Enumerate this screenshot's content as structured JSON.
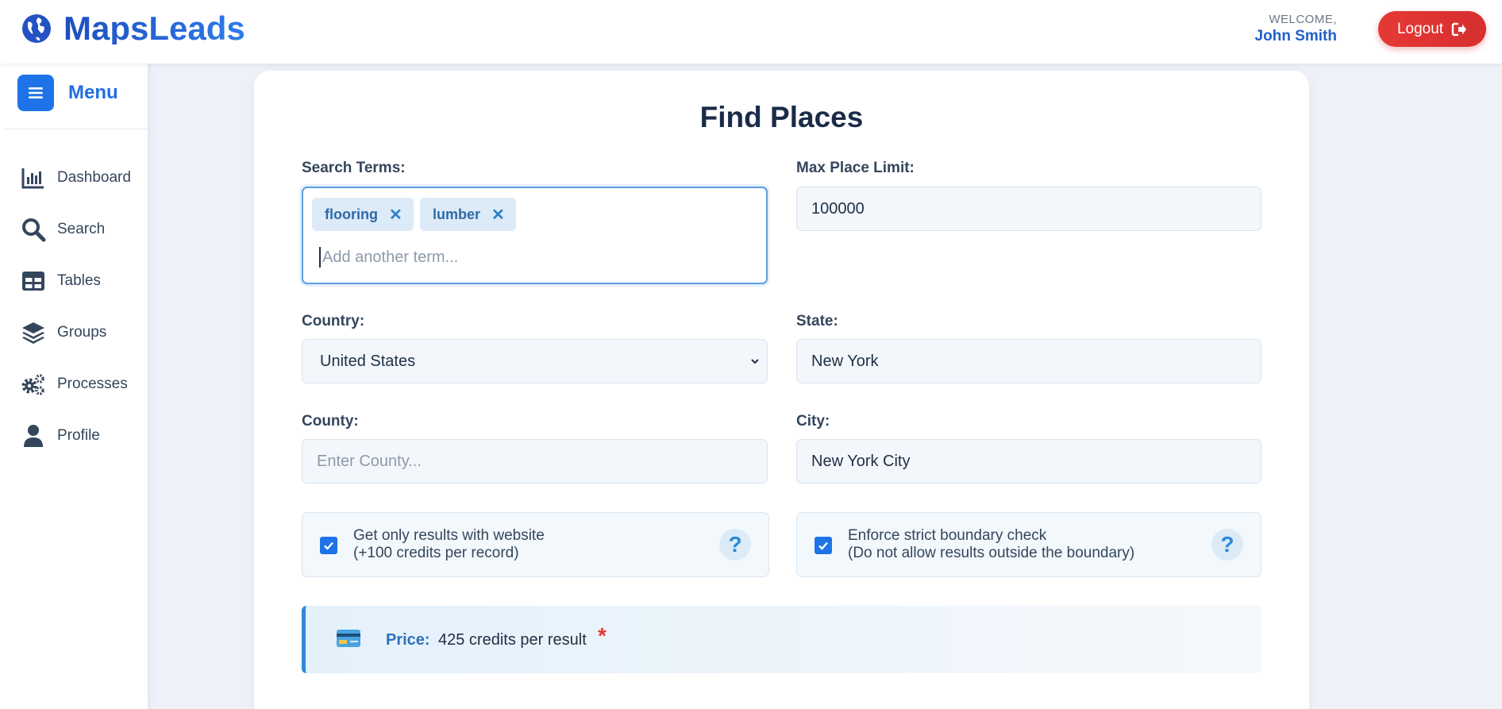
{
  "app": {
    "name": "MapsLeads"
  },
  "header": {
    "welcome_label": "WELCOME,",
    "user_name": "John Smith",
    "logout_label": "Logout"
  },
  "sidebar": {
    "menu_label": "Menu",
    "items": [
      {
        "label": "Dashboard",
        "icon": "chart-bar-icon"
      },
      {
        "label": "Search",
        "icon": "search-icon"
      },
      {
        "label": "Tables",
        "icon": "table-icon"
      },
      {
        "label": "Groups",
        "icon": "layers-icon"
      },
      {
        "label": "Processes",
        "icon": "gears-icon"
      },
      {
        "label": "Profile",
        "icon": "user-icon"
      }
    ]
  },
  "form": {
    "title": "Find Places",
    "search_terms": {
      "label": "Search Terms:",
      "chips": [
        "flooring",
        "lumber"
      ],
      "remove_glyph": "✕",
      "placeholder": "Add another term..."
    },
    "max_place_limit": {
      "label": "Max Place Limit:",
      "value": "100000"
    },
    "country": {
      "label": "Country:",
      "value": "United States"
    },
    "state": {
      "label": "State:",
      "value": "New York"
    },
    "county": {
      "label": "County:",
      "placeholder": "Enter County..."
    },
    "city": {
      "label": "City:",
      "value": "New York City"
    },
    "website_only": {
      "line1": "Get only results with website",
      "line2": "(+100 credits per record)",
      "checked": true
    },
    "strict_boundary": {
      "line1": "Enforce strict boundary check",
      "line2": "(Do not allow results outside the boundary)",
      "checked": true
    },
    "help_glyph": "?",
    "price": {
      "label": "Price:",
      "value": "425 credits per result",
      "required_mark": "*"
    }
  },
  "colors": {
    "accent": "#1f73e8",
    "logout": "#e53935",
    "price_border": "#2f8ad6"
  }
}
